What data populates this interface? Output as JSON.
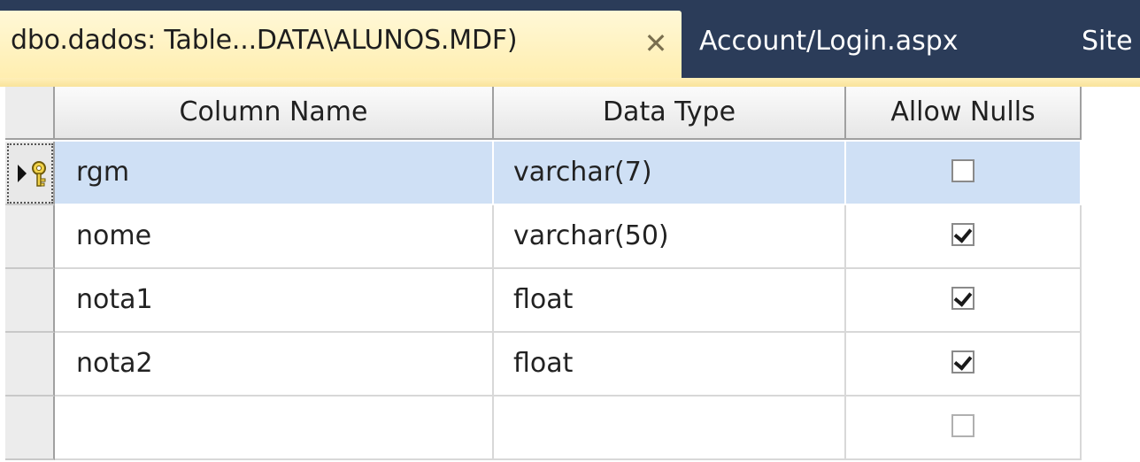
{
  "tabs": {
    "active_label": "dbo.dados: Table...DATA\\ALUNOS.MDF)",
    "close_glyph": "✕",
    "inactive": [
      {
        "label": "Account/Login.aspx"
      },
      {
        "label": "Site"
      }
    ]
  },
  "grid": {
    "headers": {
      "column_name": "Column Name",
      "data_type": "Data Type",
      "allow_nulls": "Allow Nulls"
    },
    "rows": [
      {
        "name": "rgm",
        "type": "varchar(7)",
        "allow_nulls": false,
        "primary_key": true
      },
      {
        "name": "nome",
        "type": "varchar(50)",
        "allow_nulls": true
      },
      {
        "name": "nota1",
        "type": "float",
        "allow_nulls": true
      },
      {
        "name": "nota2",
        "type": "float",
        "allow_nulls": true
      },
      {
        "name": "",
        "type": "",
        "allow_nulls": false
      }
    ]
  },
  "icons": {
    "current_row": "current-row-arrow-icon",
    "primary_key": "primary-key-icon"
  },
  "colors": {
    "tab_active": "#ffeeb0",
    "tab_strip": "#2b3c59",
    "selected_row": "#cfe0f5"
  }
}
